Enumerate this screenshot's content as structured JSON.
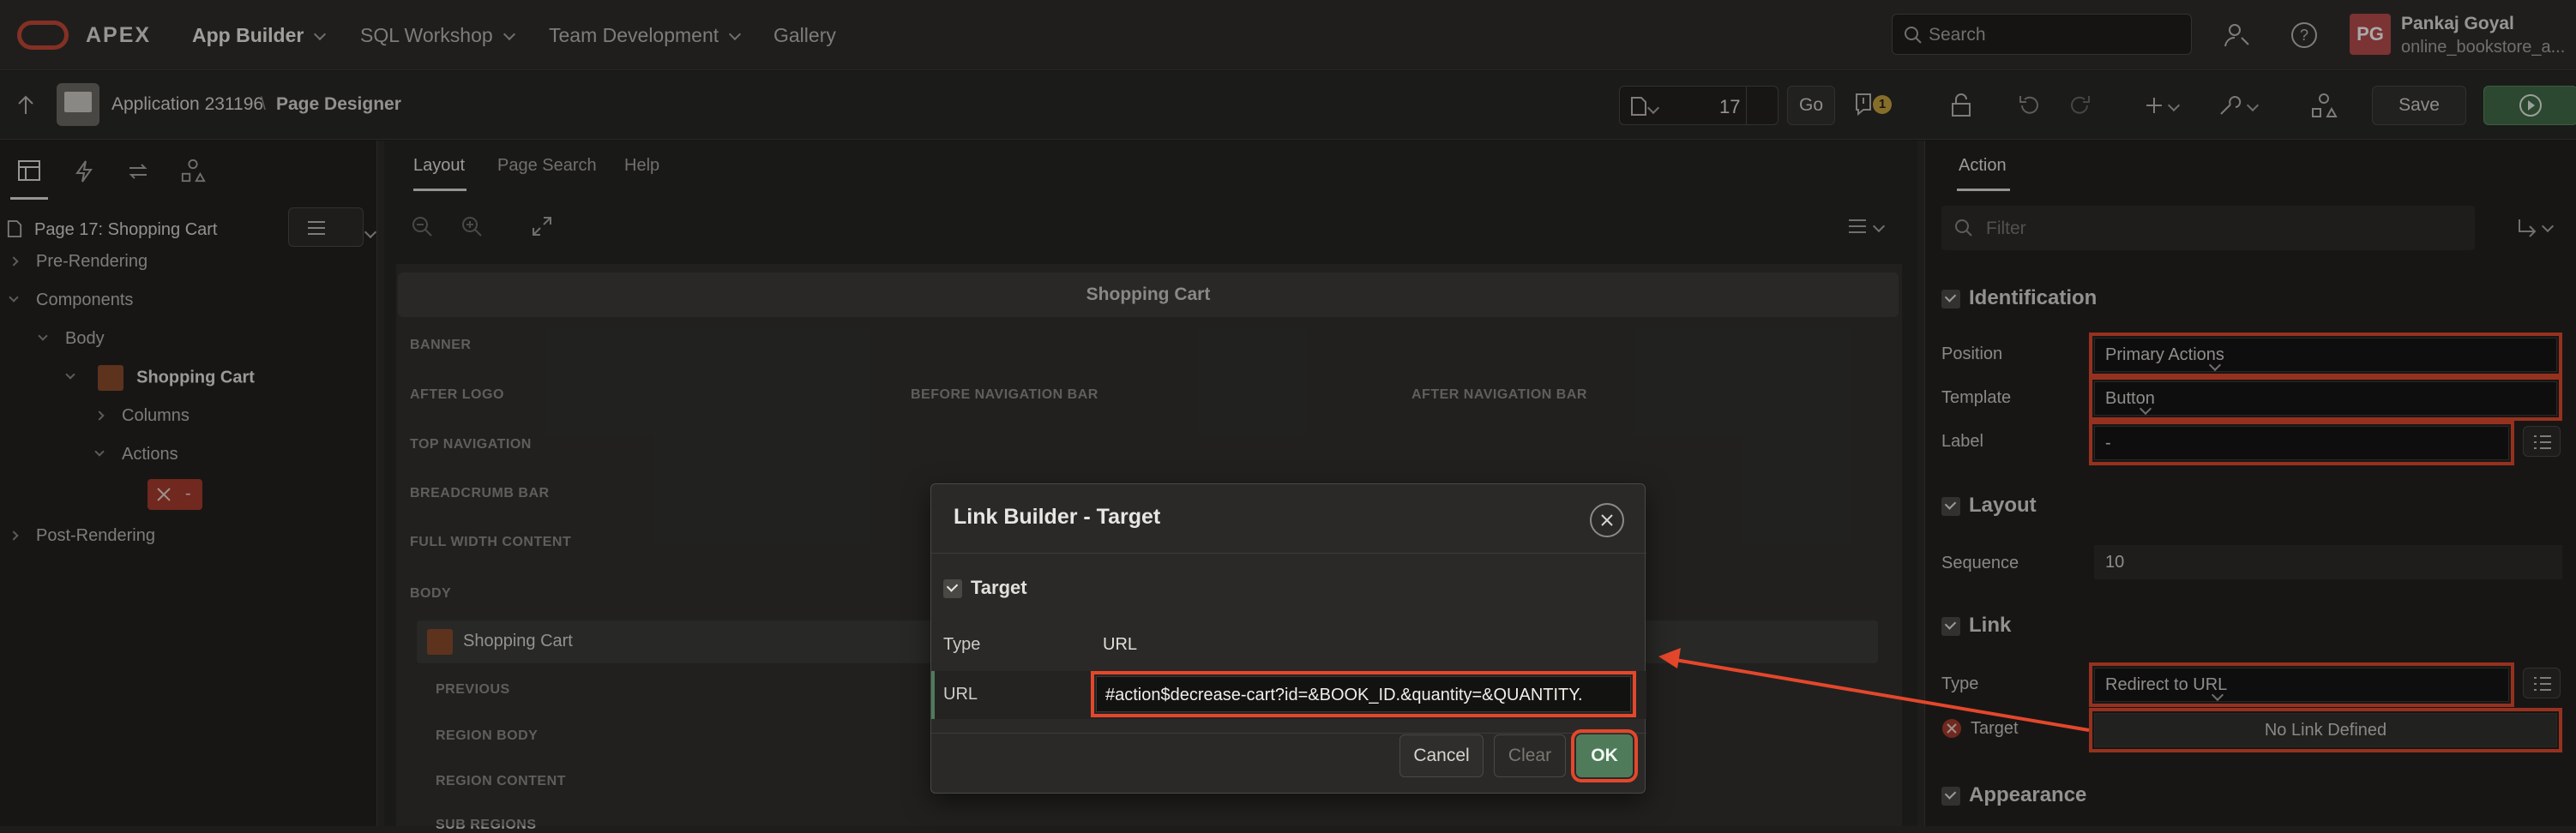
{
  "topnav": {
    "logo": "APEX",
    "items": [
      "App Builder",
      "SQL Workshop",
      "Team Development",
      "Gallery"
    ],
    "search_placeholder": "Search",
    "user_initials": "PG",
    "user_name": "Pankaj Goyal",
    "workspace": "online_bookstore_a..."
  },
  "subbar": {
    "app": "Application 231196",
    "sep": "\\",
    "page": "Page Designer",
    "page_number": "17",
    "go": "Go",
    "warn_count": "1",
    "save": "Save"
  },
  "left": {
    "root": "Page 17: Shopping Cart",
    "pre": "Pre-Rendering",
    "components": "Components",
    "body": "Body",
    "shopping_cart": "Shopping Cart",
    "columns": "Columns",
    "actions": "Actions",
    "button_label": "-",
    "post": "Post-Rendering"
  },
  "center": {
    "tabs": [
      "Layout",
      "Page Search",
      "Help"
    ],
    "page_title": "Shopping Cart",
    "regions": {
      "banner": "BANNER",
      "after_logo": "AFTER LOGO",
      "before_nav": "BEFORE NAVIGATION BAR",
      "after_nav": "AFTER NAVIGATION BAR",
      "top_nav": "TOP NAVIGATION",
      "breadcrumb": "BREADCRUMB BAR",
      "full_width": "FULL WIDTH CONTENT",
      "body": "BODY",
      "cart_region": "Shopping Cart",
      "previous": "PREVIOUS",
      "region_body": "REGION BODY",
      "region_content": "REGION CONTENT",
      "sub_regions": "SUB REGIONS"
    }
  },
  "right": {
    "tab": "Action",
    "filter_placeholder": "Filter",
    "identification": "Identification",
    "position_label": "Position",
    "position_value": "Primary Actions",
    "template_label": "Template",
    "template_value": "Button",
    "label_label": "Label",
    "label_value": "-",
    "layout": "Layout",
    "sequence_label": "Sequence",
    "sequence_value": "10",
    "link": "Link",
    "type_label": "Type",
    "type_value": "Redirect to URL",
    "target_label": "Target",
    "target_value": "No Link Defined",
    "appearance": "Appearance"
  },
  "dialog": {
    "title": "Link Builder - Target",
    "section": "Target",
    "type_label": "Type",
    "type_value": "URL",
    "url_label": "URL",
    "url_value": "#action$decrease-cart?id=&BOOK_ID.&quantity=&QUANTITY.",
    "cancel": "Cancel",
    "clear": "Clear",
    "ok": "OK"
  },
  "colors": {
    "annotation_red": "#e4472b",
    "ok_green": "#4f7b5a",
    "run_green": "#3f6b45",
    "avatar": "#b84a4a"
  }
}
